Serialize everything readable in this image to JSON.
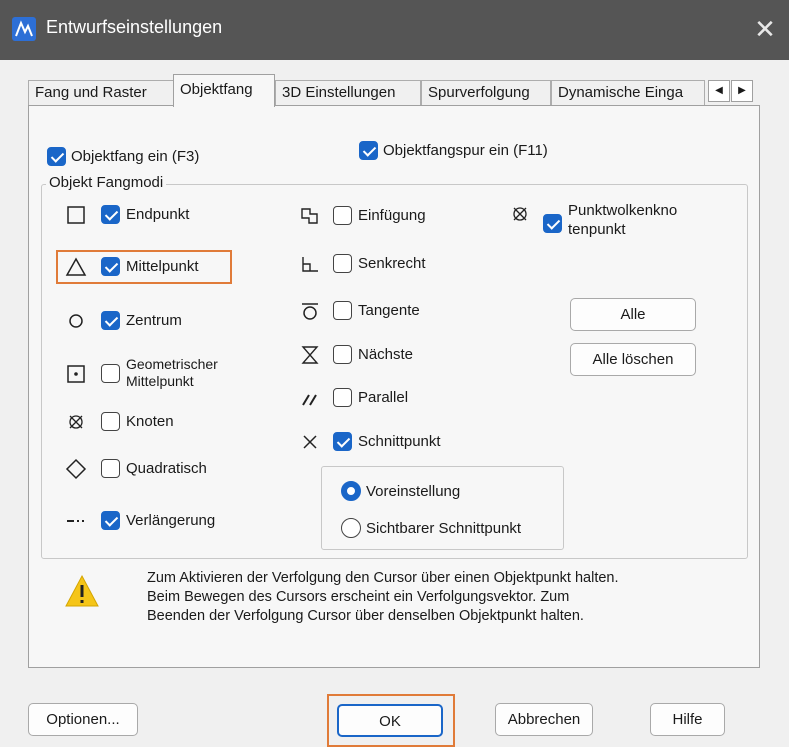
{
  "window": {
    "title": "Entwurfseinstellungen"
  },
  "tabs": [
    {
      "label": "Fang und Raster"
    },
    {
      "label": "Objektfang"
    },
    {
      "label": "3D Einstellungen"
    },
    {
      "label": "Spurverfolgung"
    },
    {
      "label": "Dynamische Einga"
    }
  ],
  "top_checks": {
    "osnap_on": {
      "label": "Objektfang ein (F3)",
      "checked": true
    },
    "osnap_track": {
      "label": "Objektfangspur ein (F11)",
      "checked": true
    }
  },
  "group_title": "Objekt Fangmodi",
  "modes_col1": [
    {
      "label": "Endpunkt",
      "checked": true,
      "icon": "square-icon"
    },
    {
      "label": "Mittelpunkt",
      "checked": true,
      "icon": "triangle-icon"
    },
    {
      "label": "Zentrum",
      "checked": true,
      "icon": "circle-icon"
    },
    {
      "label": "Geometrischer Mittelpunkt",
      "checked": false,
      "icon": "dot-square-icon"
    },
    {
      "label": "Knoten",
      "checked": false,
      "icon": "node-icon"
    },
    {
      "label": "Quadratisch",
      "checked": false,
      "icon": "diamond-icon"
    },
    {
      "label": "Verlängerung",
      "checked": true,
      "icon": "extension-icon"
    }
  ],
  "geo_mid_label_1": "Geometrischer",
  "geo_mid_label_2": "Mittelpunkt",
  "modes_col2": [
    {
      "label": "Einfügung",
      "checked": false,
      "icon": "insertion-icon"
    },
    {
      "label": "Senkrecht",
      "checked": false,
      "icon": "perpendicular-icon"
    },
    {
      "label": "Tangente",
      "checked": false,
      "icon": "tangent-icon"
    },
    {
      "label": "Nächste",
      "checked": false,
      "icon": "nearest-icon"
    },
    {
      "label": "Parallel",
      "checked": false,
      "icon": "parallel-icon"
    },
    {
      "label": "Schnittpunkt",
      "checked": true,
      "icon": "intersection-icon"
    }
  ],
  "pointcloud": {
    "label_1": "Punktwolkenkno",
    "label_2": "tenpunkt",
    "checked": true
  },
  "intersection_options": [
    {
      "label": "Voreinstellung",
      "selected": true
    },
    {
      "label": "Sichtbarer Schnittpunkt",
      "selected": false
    }
  ],
  "side_buttons": {
    "all": "Alle",
    "clear_all": "Alle löschen"
  },
  "info": {
    "line1": "Zum Aktivieren der Verfolgung den Cursor über einen Objektpunkt halten.",
    "line2": "Beim Bewegen des Cursors erscheint ein Verfolgungsvektor. Zum",
    "line3": "Beenden der Verfolgung Cursor über denselben Objektpunkt halten."
  },
  "footer": {
    "options": "Optionen...",
    "ok": "OK",
    "cancel": "Abbrechen",
    "help": "Hilfe"
  },
  "colors": {
    "accent": "#1a66c8",
    "highlight": "#e07b39",
    "warning": "#f5c518",
    "titlebar": "#555555"
  }
}
